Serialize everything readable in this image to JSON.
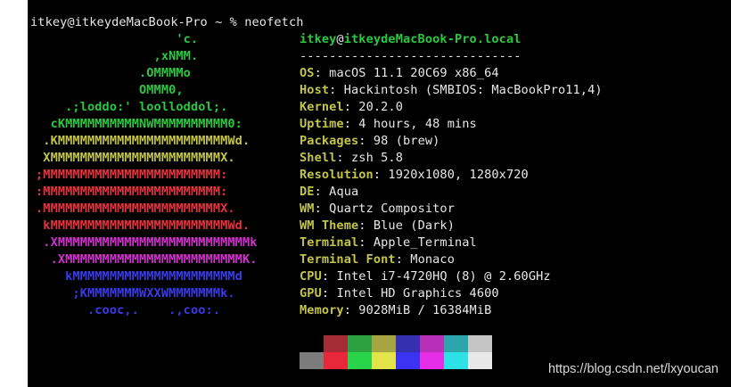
{
  "terminal": {
    "prompt_line": "itkey@itkeydeMacBook-Pro ~ % neofetch"
  },
  "logo": [
    {
      "text": "                   'c.",
      "color": "#2bc840"
    },
    {
      "text": "                ,xNMM.",
      "color": "#2bc840"
    },
    {
      "text": "              .OMMMMo",
      "color": "#2bc840"
    },
    {
      "text": "              OMMM0,",
      "color": "#2bc840"
    },
    {
      "text": "    .;loddo:' loolloddol;.",
      "color": "#2bc840"
    },
    {
      "text": "  cKMMMMMMMMMMNWMMMMMMMMMM0:",
      "color": "#2bc840"
    },
    {
      "text": " .KMMMMMMMMMMMMMMMMMMMMMMMWd.",
      "color": "#c3c44a"
    },
    {
      "text": " XMMMMMMMMMMMMMMMMMMMMMMMX.",
      "color": "#c3c44a"
    },
    {
      "text": ";MMMMMMMMMMMMMMMMMMMMMMMM:",
      "color": "#e8333e"
    },
    {
      "text": ":MMMMMMMMMMMMMMMMMMMMMMMM:",
      "color": "#e8333e"
    },
    {
      "text": ".MMMMMMMMMMMMMMMMMMMMMMMMX.",
      "color": "#e8333e"
    },
    {
      "text": " kMMMMMMMMMMMMMMMMMMMMMMMMWd.",
      "color": "#e8333e"
    },
    {
      "text": " .XMMMMMMMMMMMMMMMMMMMMMMMMMMk",
      "color": "#d42fd0"
    },
    {
      "text": "  .XMMMMMMMMMMMMMMMMMMMMMMMMK.",
      "color": "#d42fd0"
    },
    {
      "text": "    kMMMMMMMMMMMMMMMMMMMMMMd",
      "color": "#3a3ae8"
    },
    {
      "text": "     ;KMMMMMMMWXXWMMMMMMMk.",
      "color": "#3a3ae8"
    },
    {
      "text": "       .cooc,.    .,coo:.",
      "color": "#3a3ae8"
    }
  ],
  "info": {
    "user": "itkey",
    "at": "@",
    "host": "itkeydeMacBook-Pro.local",
    "separator": "------------------------------",
    "rows": [
      {
        "label": "OS",
        "value": "macOS 11.1 20C69 x86_64"
      },
      {
        "label": "Host",
        "value": "Hackintosh (SMBIOS: MacBookPro11,4)"
      },
      {
        "label": "Kernel",
        "value": "20.2.0"
      },
      {
        "label": "Uptime",
        "value": "4 hours, 48 mins"
      },
      {
        "label": "Packages",
        "value": "98 (brew)"
      },
      {
        "label": "Shell",
        "value": "zsh 5.8"
      },
      {
        "label": "Resolution",
        "value": "1920x1080, 1280x720"
      },
      {
        "label": "DE",
        "value": "Aqua"
      },
      {
        "label": "WM",
        "value": "Quartz Compositor"
      },
      {
        "label": "WM Theme",
        "value": "Blue (Dark)"
      },
      {
        "label": "Terminal",
        "value": "Apple_Terminal"
      },
      {
        "label": "Terminal Font",
        "value": "Monaco"
      },
      {
        "label": "CPU",
        "value": "Intel i7-4720HQ (8) @ 2.60GHz"
      },
      {
        "label": "GPU",
        "value": "Intel HD Graphics 4600"
      },
      {
        "label": "Memory",
        "value": "9028MiB / 16384MiB"
      }
    ],
    "label_suffix": ": "
  },
  "palette": {
    "normal": [
      "#000000",
      "#a42c34",
      "#2ca140",
      "#a5a543",
      "#3530b0",
      "#b730b7",
      "#2ca6aa",
      "#c5c5c5"
    ],
    "bright": [
      "#7c7c7c",
      "#e8283a",
      "#2ad44a",
      "#e3e34a",
      "#3a34f2",
      "#e52ee5",
      "#2ce2e5",
      "#e8e8e8"
    ]
  },
  "watermark": "https://blog.csdn.net/lxyoucan"
}
